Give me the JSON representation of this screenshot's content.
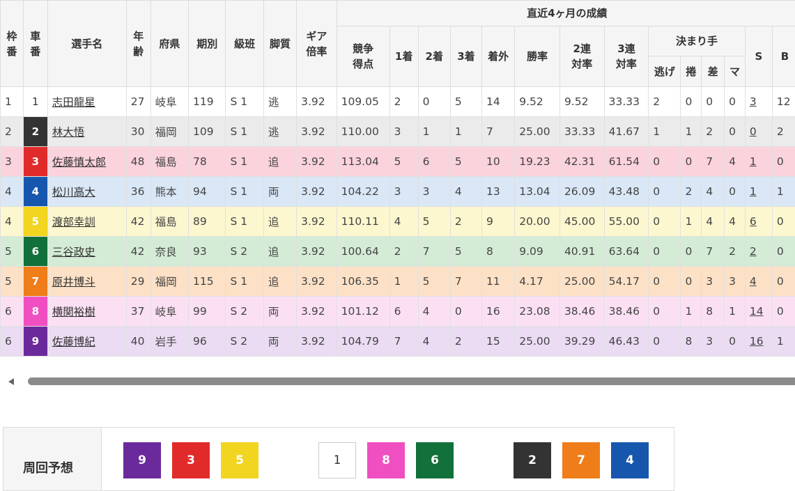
{
  "colors": {
    "car1_bg": "#ffffff",
    "car1_fg": "#333333",
    "car2_bg": "#333333",
    "car2_fg": "#ffffff",
    "car3_bg": "#e12b2b",
    "car3_fg": "#ffffff",
    "car4_bg": "#1657ad",
    "car4_fg": "#ffffff",
    "car5_bg": "#f1d520",
    "car5_fg": "#ffffff",
    "car6_bg": "#12703a",
    "car6_fg": "#ffffff",
    "car7_bg": "#ef7d1a",
    "car7_fg": "#ffffff",
    "car8_bg": "#f04fc2",
    "car8_fg": "#ffffff",
    "car9_bg": "#6b2a9b",
    "car9_fg": "#ffffff"
  },
  "headers": {
    "waku": [
      "枠",
      "番"
    ],
    "sha": [
      "車",
      "番"
    ],
    "name": "選手名",
    "age": [
      "年",
      "齢"
    ],
    "pref": "府県",
    "term": "期別",
    "class": "級班",
    "style": "脚質",
    "gear": [
      "ギア",
      "倍率"
    ],
    "recent": "直近4ヶ月の成績",
    "score": [
      "競争",
      "得点"
    ],
    "first": "1着",
    "second": "2着",
    "third": "3着",
    "out": "着外",
    "winrate": "勝率",
    "rentai2": [
      "2連",
      "対率"
    ],
    "rentai3": [
      "3連",
      "対率"
    ],
    "kimarite": "決まり手",
    "nige": "逃げ",
    "makuri": "捲",
    "sashi": "差",
    "mark": "マ",
    "s": "S",
    "b": "B"
  },
  "rows": [
    {
      "waku": "1",
      "car": "1",
      "name": "志田龍星",
      "age": "27",
      "pref": "岐阜",
      "term": "119",
      "class": "S 1",
      "style": "逃",
      "gear": "3.92",
      "score": "109.05",
      "first": "2",
      "second": "0",
      "third": "5",
      "out": "14",
      "winrate": "9.52",
      "r2": "9.52",
      "r3": "33.33",
      "nige": "2",
      "makuri": "0",
      "sashi": "0",
      "mark": "0",
      "s": "3",
      "b": "12",
      "row_bg": "#ffffff"
    },
    {
      "waku": "2",
      "car": "2",
      "name": "林大悟",
      "age": "30",
      "pref": "福岡",
      "term": "109",
      "class": "S 1",
      "style": "逃",
      "gear": "3.92",
      "score": "110.00",
      "first": "3",
      "second": "1",
      "third": "1",
      "out": "7",
      "winrate": "25.00",
      "r2": "33.33",
      "r3": "41.67",
      "nige": "1",
      "makuri": "1",
      "sashi": "2",
      "mark": "0",
      "s": "0",
      "b": "2",
      "row_bg": "#ebebeb"
    },
    {
      "waku": "3",
      "car": "3",
      "name": "佐藤慎太郎",
      "age": "48",
      "pref": "福島",
      "term": "78",
      "class": "S 1",
      "style": "追",
      "gear": "3.92",
      "score": "113.04",
      "first": "5",
      "second": "6",
      "third": "5",
      "out": "10",
      "winrate": "19.23",
      "r2": "42.31",
      "r3": "61.54",
      "nige": "0",
      "makuri": "0",
      "sashi": "7",
      "mark": "4",
      "s": "1",
      "b": "0",
      "row_bg": "#fbd3dc"
    },
    {
      "waku": "4",
      "car": "4",
      "name": "松川高大",
      "age": "36",
      "pref": "熊本",
      "term": "94",
      "class": "S 1",
      "style": "両",
      "gear": "3.92",
      "score": "104.22",
      "first": "3",
      "second": "3",
      "third": "4",
      "out": "13",
      "winrate": "13.04",
      "r2": "26.09",
      "r3": "43.48",
      "nige": "0",
      "makuri": "2",
      "sashi": "4",
      "mark": "0",
      "s": "1",
      "b": "1",
      "row_bg": "#d9e7f6"
    },
    {
      "waku": "4",
      "car": "5",
      "name": "渡部幸訓",
      "age": "42",
      "pref": "福島",
      "term": "89",
      "class": "S 1",
      "style": "追",
      "gear": "3.92",
      "score": "110.11",
      "first": "4",
      "second": "5",
      "third": "2",
      "out": "9",
      "winrate": "20.00",
      "r2": "45.00",
      "r3": "55.00",
      "nige": "0",
      "makuri": "1",
      "sashi": "4",
      "mark": "4",
      "s": "6",
      "b": "0",
      "row_bg": "#fdf7cf"
    },
    {
      "waku": "5",
      "car": "6",
      "name": "三谷政史",
      "age": "42",
      "pref": "奈良",
      "term": "93",
      "class": "S 2",
      "style": "追",
      "gear": "3.92",
      "score": "100.64",
      "first": "2",
      "second": "7",
      "third": "5",
      "out": "8",
      "winrate": "9.09",
      "r2": "40.91",
      "r3": "63.64",
      "nige": "0",
      "makuri": "0",
      "sashi": "7",
      "mark": "2",
      "s": "2",
      "b": "0",
      "row_bg": "#d4ecd6"
    },
    {
      "waku": "5",
      "car": "7",
      "name": "原井博斗",
      "age": "29",
      "pref": "福岡",
      "term": "115",
      "class": "S 1",
      "style": "追",
      "gear": "3.92",
      "score": "106.35",
      "first": "1",
      "second": "5",
      "third": "7",
      "out": "11",
      "winrate": "4.17",
      "r2": "25.00",
      "r3": "54.17",
      "nige": "0",
      "makuri": "0",
      "sashi": "3",
      "mark": "3",
      "s": "4",
      "b": "0",
      "row_bg": "#fde1c6"
    },
    {
      "waku": "6",
      "car": "8",
      "name": "横関裕樹",
      "age": "37",
      "pref": "岐阜",
      "term": "99",
      "class": "S 2",
      "style": "両",
      "gear": "3.92",
      "score": "101.12",
      "first": "6",
      "second": "4",
      "third": "0",
      "out": "16",
      "winrate": "23.08",
      "r2": "38.46",
      "r3": "38.46",
      "nige": "0",
      "makuri": "1",
      "sashi": "8",
      "mark": "1",
      "s": "14",
      "b": "0",
      "row_bg": "#fbe0f4"
    },
    {
      "waku": "6",
      "car": "9",
      "name": "佐藤博紀",
      "age": "40",
      "pref": "岩手",
      "term": "96",
      "class": "S 2",
      "style": "両",
      "gear": "3.92",
      "score": "104.79",
      "first": "7",
      "second": "4",
      "third": "2",
      "out": "15",
      "winrate": "25.00",
      "r2": "39.29",
      "r3": "46.43",
      "nige": "0",
      "makuri": "8",
      "sashi": "3",
      "mark": "0",
      "s": "16",
      "b": "1",
      "row_bg": "#ebdcf3"
    }
  ],
  "yoso": {
    "label": "周回予想",
    "line_order": [
      "9",
      "3",
      "5",
      "1",
      "8",
      "6",
      "2",
      "7",
      "4"
    ]
  },
  "scroll": {
    "left_arrow": "scroll-left-icon"
  }
}
